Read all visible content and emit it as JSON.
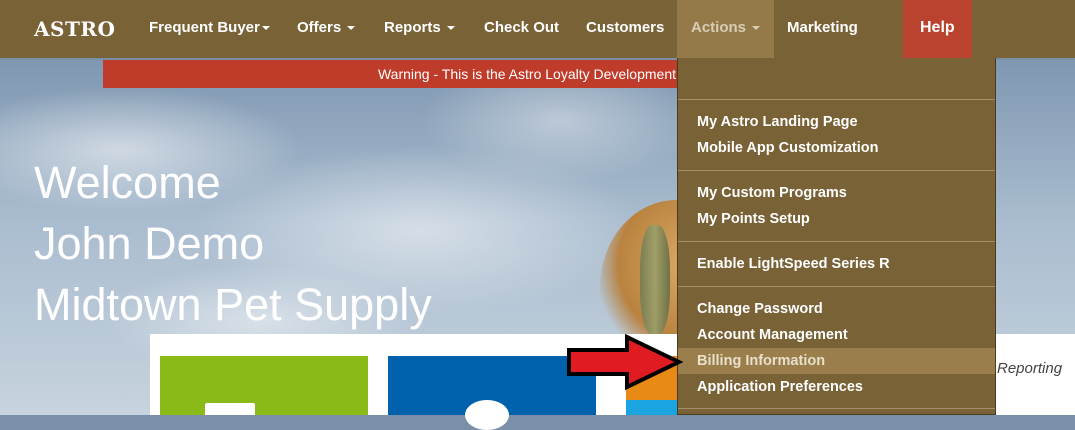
{
  "brand": "ASTRO",
  "nav": {
    "frequent_buyer": "Frequent Buyer",
    "offers": "Offers",
    "reports": "Reports",
    "check_out": "Check Out",
    "customers": "Customers",
    "actions": "Actions",
    "marketing": "Marketing",
    "help": "Help"
  },
  "warning": "Warning - This is the Astro Loyalty Development",
  "welcome": {
    "line1": "Welcome",
    "line2": "John Demo",
    "line3": "Midtown Pet Supply"
  },
  "reporting": "Reporting",
  "actions_menu": {
    "items": [
      "My Astro Landing Page",
      "Mobile App Customization",
      "My Custom Programs",
      "My Points Setup",
      "Enable LightSpeed Series R",
      "Change Password",
      "Account Management",
      "Billing Information",
      "Application Preferences"
    ],
    "highlighted": "Billing Information"
  },
  "colors": {
    "navbar": "#7a6237",
    "help": "#b9432e",
    "warning": "#bf3b2a",
    "arrow": "#e11b22"
  }
}
